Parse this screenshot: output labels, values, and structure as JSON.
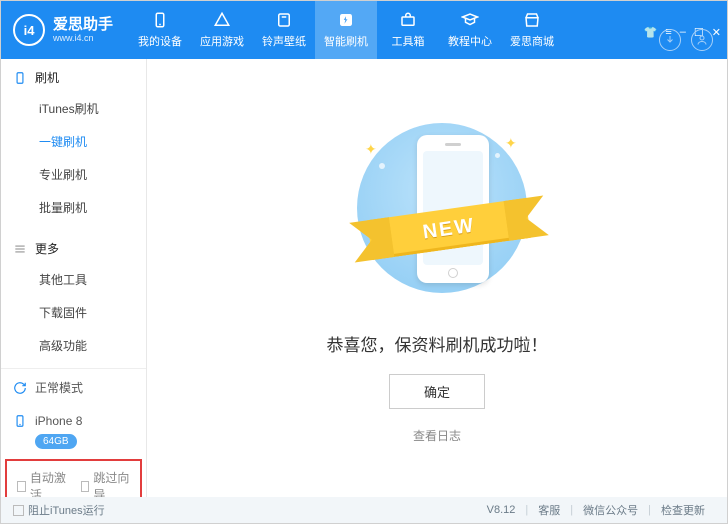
{
  "brand": {
    "icon": "i4",
    "name": "爱思助手",
    "url": "www.i4.cn"
  },
  "nav": [
    {
      "label": "我的设备"
    },
    {
      "label": "应用游戏"
    },
    {
      "label": "铃声壁纸"
    },
    {
      "label": "智能刷机"
    },
    {
      "label": "工具箱"
    },
    {
      "label": "教程中心"
    },
    {
      "label": "爱思商城"
    }
  ],
  "sidebar": {
    "group1": {
      "title": "刷机",
      "items": [
        "iTunes刷机",
        "一键刷机",
        "专业刷机",
        "批量刷机"
      ]
    },
    "group2": {
      "title": "更多",
      "items": [
        "其他工具",
        "下载固件",
        "高级功能"
      ]
    },
    "mode": "正常模式",
    "device": {
      "name": "iPhone 8",
      "storage": "64GB"
    },
    "autoActivate": "自动激活",
    "skipGuide": "跳过向导"
  },
  "main": {
    "message": "恭喜您，保资料刷机成功啦！",
    "ok": "确定",
    "log": "查看日志",
    "ribbon": "NEW"
  },
  "footer": {
    "blockItunes": "阻止iTunes运行",
    "version": "V8.12",
    "cs": "客服",
    "wechat": "微信公众号",
    "update": "检查更新"
  }
}
